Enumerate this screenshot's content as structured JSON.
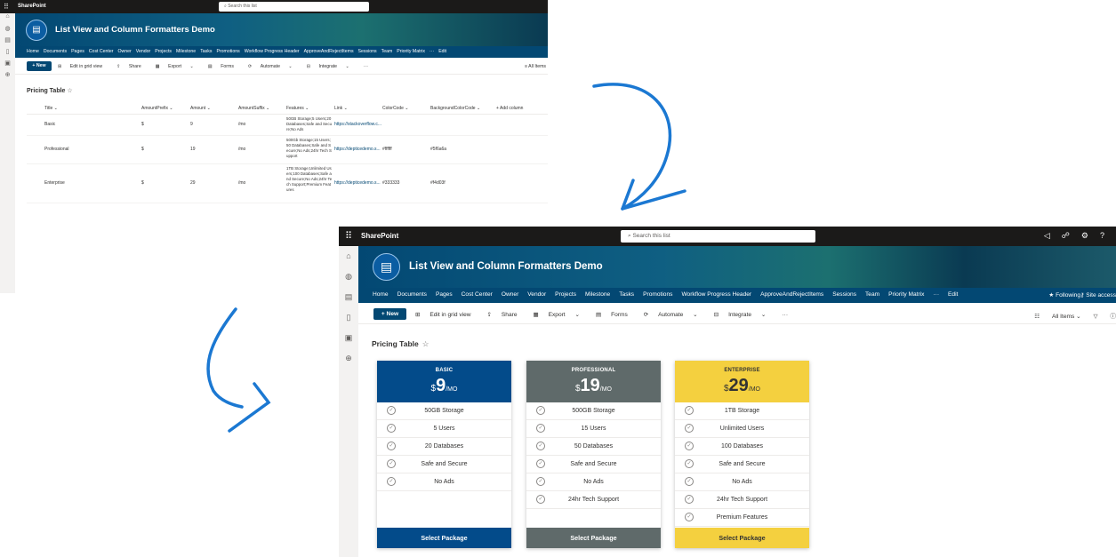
{
  "app": "SharePoint",
  "search": {
    "placeholder": "Search this list"
  },
  "site_title": "List View and Column Formatters Demo",
  "nav": [
    "Home",
    "Documents",
    "Pages",
    "Cost Center",
    "Owner",
    "Vendor",
    "Projects",
    "Milestone",
    "Tasks",
    "Promotions",
    "Workflow Progress Header",
    "ApproveAndRejectItems",
    "Sessions",
    "Team",
    "Priority Matrix",
    "···",
    "Edit"
  ],
  "nav_right": {
    "following": "Following",
    "site_access": "Site access"
  },
  "command_bar": {
    "new": "+ New",
    "items": [
      "Edit in grid view",
      "Share",
      "Export",
      "Forms",
      "Automate",
      "Integrate",
      "···"
    ],
    "view": "All Items"
  },
  "list_title": "Pricing Table",
  "table": {
    "columns": [
      "Title",
      "AmountPrefix",
      "Amount",
      "AmountSuffix",
      "Features",
      "Link",
      "ColorCode",
      "BackgroundColorCode",
      "+ Add column"
    ],
    "rows": [
      {
        "title": "Basic",
        "prefix": "$",
        "amount": "9",
        "suffix": "/mo",
        "features": "50GB Storage;5 Users;20 Databases;Safe and Secure;No Ads",
        "link": "https://stackoverflow.c...",
        "color": "",
        "bg": ""
      },
      {
        "title": "Professional",
        "prefix": "$",
        "amount": "19",
        "suffix": "/mo",
        "features": "500Gb Storage;15 Users;50 Databases;Safe and Secure;No Ads;24hr Tech Support",
        "link": "https://depticedemo.s...",
        "color": "#ffffff",
        "bg": "#5f6a6a"
      },
      {
        "title": "Enterprise",
        "prefix": "$",
        "amount": "29",
        "suffix": "/mo",
        "features": "1TB Storage;Unlimited Users;100 Databases;Safe and Secure;No Ads;24hr Tech Support;Premium Features",
        "link": "https://depticedemo.s...",
        "color": "#333333",
        "bg": "#f4d03f"
      }
    ]
  },
  "cards": [
    {
      "name": "BASIC",
      "currency": "$",
      "amount": "9",
      "suffix": "/MO",
      "header_bg": "#034b8a",
      "text_color": "#ffffff",
      "button": "Select Package",
      "features": [
        "50GB Storage",
        "5 Users",
        "20 Databases",
        "Safe and Secure",
        "No Ads"
      ]
    },
    {
      "name": "PROFESSIONAL",
      "currency": "$",
      "amount": "19",
      "suffix": "/MO",
      "header_bg": "#5f6a6a",
      "text_color": "#ffffff",
      "button": "Select Package",
      "features": [
        "500GB Storage",
        "15 Users",
        "50 Databases",
        "Safe and Secure",
        "No Ads",
        "24hr Tech Support"
      ]
    },
    {
      "name": "ENTERPRISE",
      "currency": "$",
      "amount": "29",
      "suffix": "/MO",
      "header_bg": "#f4d03f",
      "text_color": "#333333",
      "button": "Select Package",
      "features": [
        "1TB Storage",
        "Unlimited Users",
        "100 Databases",
        "Safe and Secure",
        "No Ads",
        "24hr Tech Support",
        "Premium Features"
      ]
    }
  ],
  "colors": {
    "suitebar": "#1b1a19",
    "nav": "#034873",
    "arrow": "#1b78d2"
  },
  "icons": [
    "waffle-icon",
    "search-icon",
    "star-icon",
    "check-circle-icon",
    "megaphone-icon",
    "share-icon",
    "gear-icon",
    "help-icon",
    "filter-icon",
    "info-icon"
  ]
}
